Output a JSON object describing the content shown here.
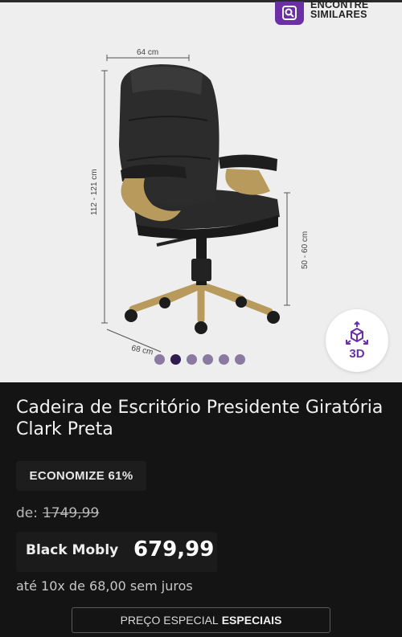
{
  "similar_button": {
    "line1": "ENCONTRE",
    "line2": "SIMILARES",
    "icon": "find-similar-icon"
  },
  "image": {
    "dimensions": {
      "width": "64 cm",
      "height": "112 - 121 cm",
      "seat_height": "50 - 60 cm",
      "depth": "68 cm"
    },
    "dots_count": 6,
    "active_dot": 1
  },
  "view_3d": {
    "label": "3D",
    "icon": "cube-3d-icon"
  },
  "product": {
    "title": "Cadeira de Escritório Presidente Giratória Clark Preta",
    "discount": "ECONOMIZE 61%",
    "old_price_label": "de:",
    "old_price": "1749,99",
    "store": "Black Mobly",
    "price": "679,99",
    "installments": "até 10x de 68,00 sem juros"
  },
  "special_price": {
    "label": "PREÇO ESPECIAL",
    "highlight": "ESPECIAIS"
  },
  "colors": {
    "accent": "#6b2fa6",
    "background": "#141414",
    "gallery_bg": "#eeeeee"
  }
}
